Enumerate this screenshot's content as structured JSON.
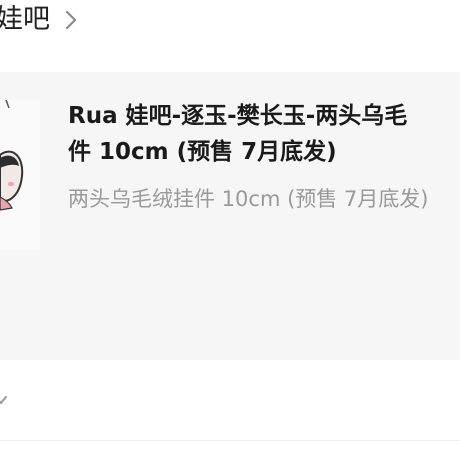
{
  "shop": {
    "name": "娃吧",
    "chevron_icon": "chevron-right-icon"
  },
  "product": {
    "title_line1": "Rua 娃吧-逐玉-樊长玉-两头乌毛",
    "title_line2": "件 10cm (预售 7月底发)",
    "subtitle": "两头乌毛绒挂件 10cm (预售 7月底发)",
    "thumbnail_icon": "plush-doll-thumbnail"
  },
  "footer": {
    "chevron_icon": "chevron-down-icon"
  },
  "colors": {
    "page_background": "#ffffff",
    "card_background": "#f6f6f6",
    "title_text": "#1a1a1a",
    "subtitle_text": "#9a9a9a"
  }
}
